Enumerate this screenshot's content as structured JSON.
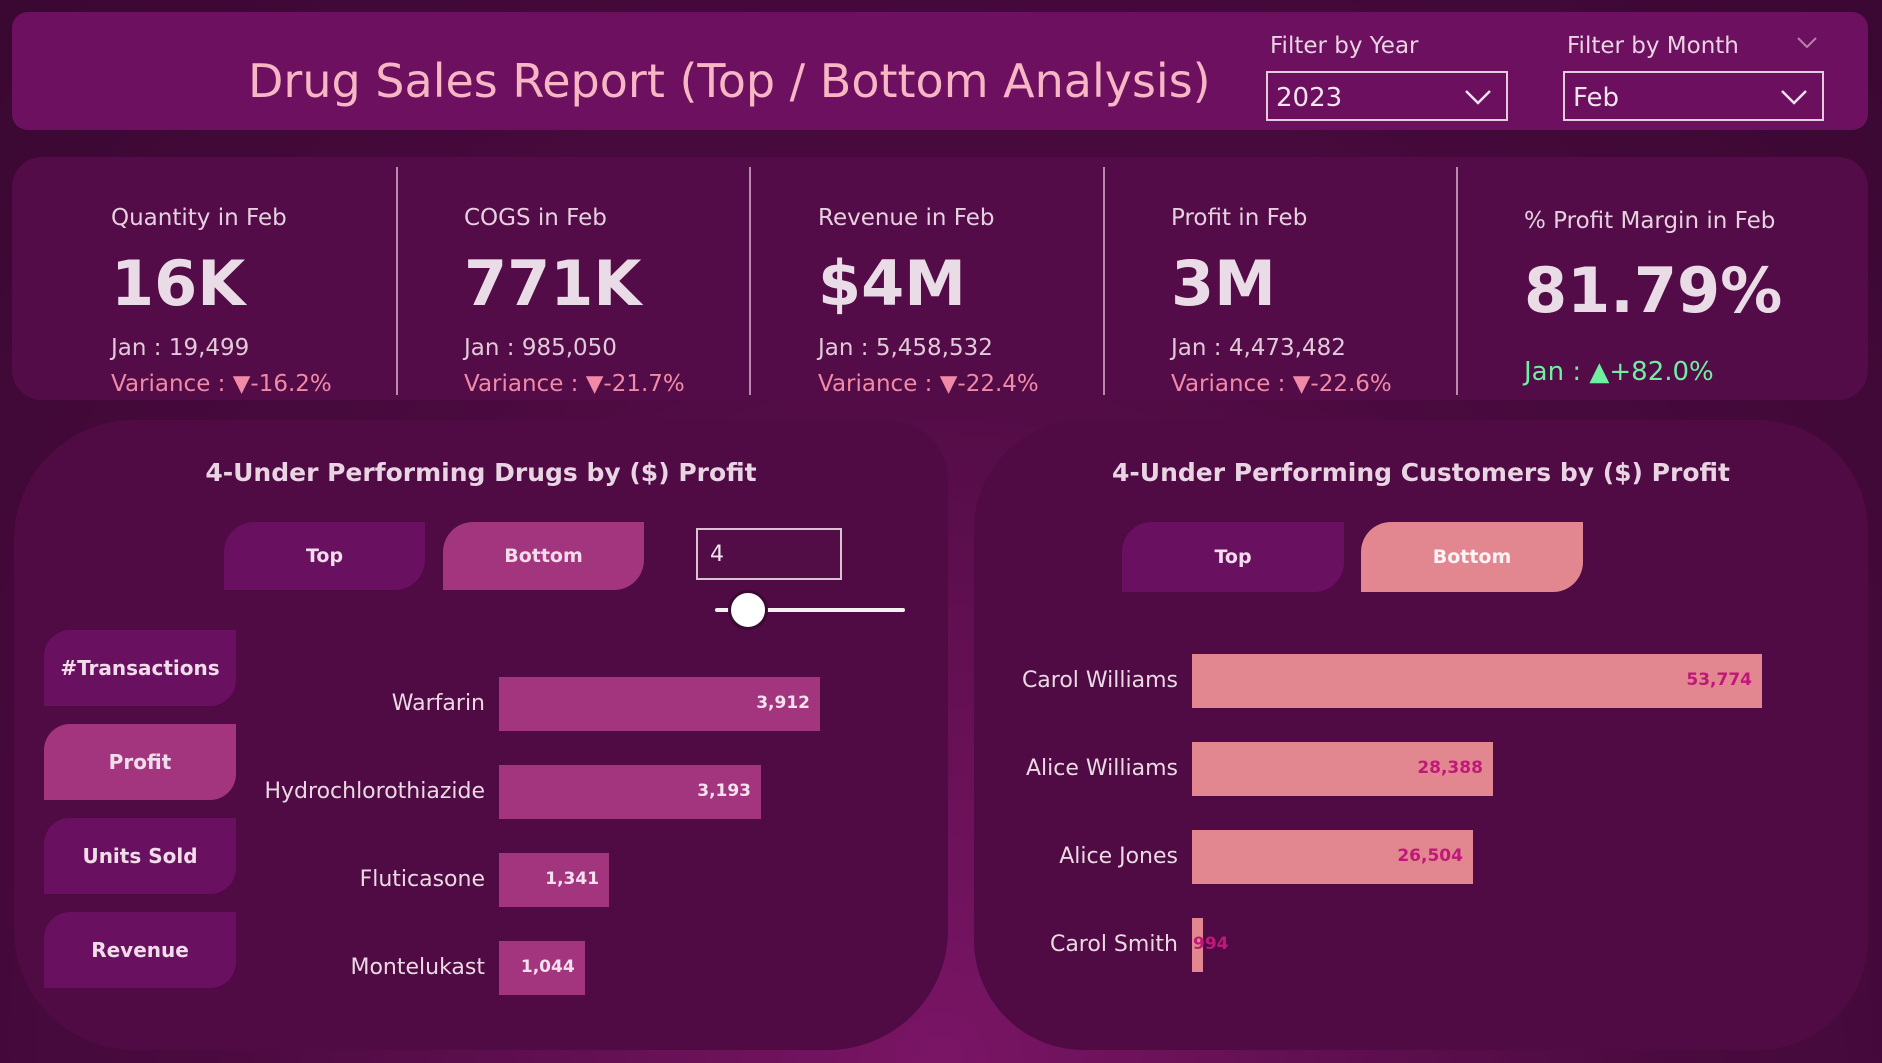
{
  "header": {
    "title": "Drug Sales Report (Top / Bottom Analysis)",
    "filter_year": {
      "label": "Filter by Year",
      "value": "2023"
    },
    "filter_month": {
      "label": "Filter by Month",
      "value": "Feb"
    }
  },
  "kpis": [
    {
      "title": "Quantity in Feb",
      "value": "16K",
      "prev": "Jan : 19,499",
      "variance": "Variance : ▼-16.2%"
    },
    {
      "title": "COGS in Feb",
      "value": "771K",
      "prev": "Jan : 985,050",
      "variance": "Variance : ▼-21.7%"
    },
    {
      "title": "Revenue in Feb",
      "value": "$4M",
      "prev": "Jan : 5,458,532",
      "variance": "Variance : ▼-22.4%"
    },
    {
      "title": "Profit in Feb",
      "value": "3M",
      "prev": "Jan : 4,473,482",
      "variance": "Variance : ▼-22.6%"
    },
    {
      "title": "% Profit Margin in Feb",
      "value": "81.79%",
      "prev": "Jan : ▲+82.0%"
    }
  ],
  "drugs_card": {
    "title": "4-Under Performing Drugs by ($) Profit",
    "top_label": "Top",
    "bottom_label": "Bottom",
    "n_value": "4",
    "metrics": [
      "#Transactions",
      "Profit",
      "Units Sold",
      "Revenue"
    ],
    "selected_metric": "Profit"
  },
  "customers_card": {
    "title": "4-Under Performing Customers by ($) Profit",
    "top_label": "Top",
    "bottom_label": "Bottom"
  },
  "colors": {
    "accent_pink": "#e2878f",
    "accent_magenta": "#a3357f",
    "variance_down": "#f08aa6",
    "variance_up": "#6ef0a0"
  },
  "chart_data": [
    {
      "type": "bar",
      "orientation": "horizontal",
      "categories": [
        "Warfarin",
        "Hydrochlorothiazide",
        "Fluticasone",
        "Montelukast"
      ],
      "values": [
        3912,
        3193,
        1341,
        1044
      ],
      "value_labels": [
        "3,912",
        "3,193",
        "1,341",
        "1,044"
      ],
      "color": "#a3357f"
    },
    {
      "type": "bar",
      "orientation": "horizontal",
      "categories": [
        "Carol Williams",
        "Alice Williams",
        "Alice Jones",
        "Carol Smith"
      ],
      "values": [
        53774,
        28388,
        26504,
        994
      ],
      "value_labels": [
        "53,774",
        "28,388",
        "26,504",
        "994"
      ],
      "color": "#e2878f"
    }
  ]
}
